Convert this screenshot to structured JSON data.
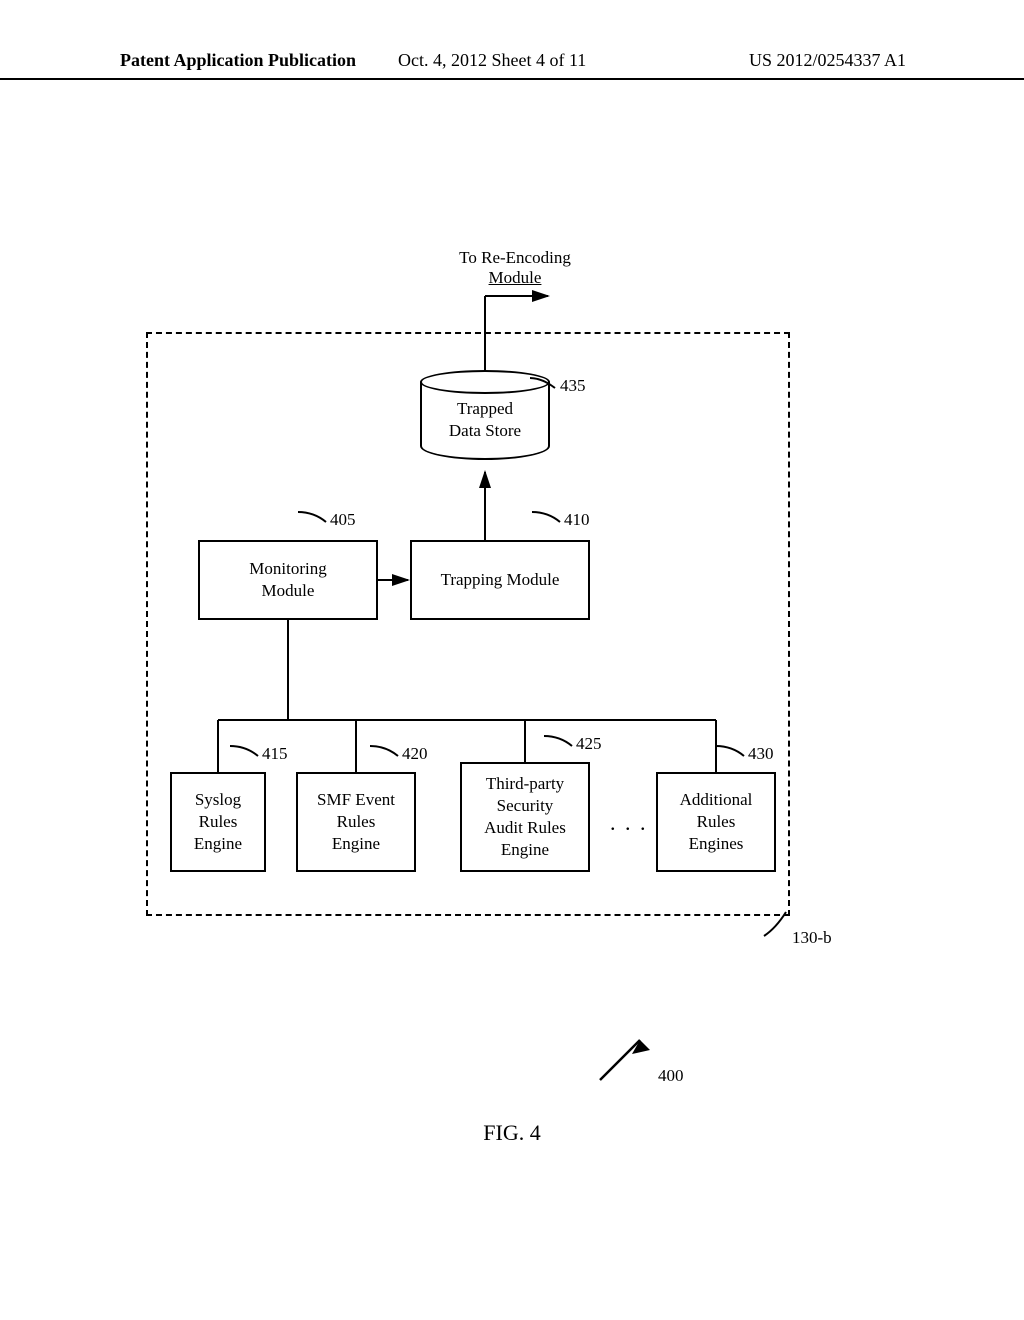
{
  "header": {
    "left": "Patent Application Publication",
    "middle": "Oct. 4, 2012   Sheet 4 of 11",
    "right": "US 2012/0254337 A1"
  },
  "top_label": {
    "line1": "To Re-Encoding",
    "line2": "Module"
  },
  "cylinder": {
    "line1": "Trapped",
    "line2": "Data Store"
  },
  "boxes": {
    "monitoring": {
      "line1": "Monitoring",
      "line2": "Module"
    },
    "trapping": {
      "label": "Trapping Module"
    },
    "syslog": {
      "line1": "Syslog",
      "line2": "Rules",
      "line3": "Engine"
    },
    "smf": {
      "line1": "SMF Event",
      "line2": "Rules",
      "line3": "Engine"
    },
    "security": {
      "line1": "Third-party",
      "line2": "Security",
      "line3": "Audit Rules",
      "line4": "Engine"
    },
    "additional": {
      "line1": "Additional",
      "line2": "Rules",
      "line3": "Engines"
    }
  },
  "refs": {
    "r405": "405",
    "r410": "410",
    "r415": "415",
    "r420": "420",
    "r425": "425",
    "r430": "430",
    "r435": "435",
    "r130b": "130-b",
    "r400": "400"
  },
  "ellipsis": ". . .",
  "caption": "FIG. 4"
}
